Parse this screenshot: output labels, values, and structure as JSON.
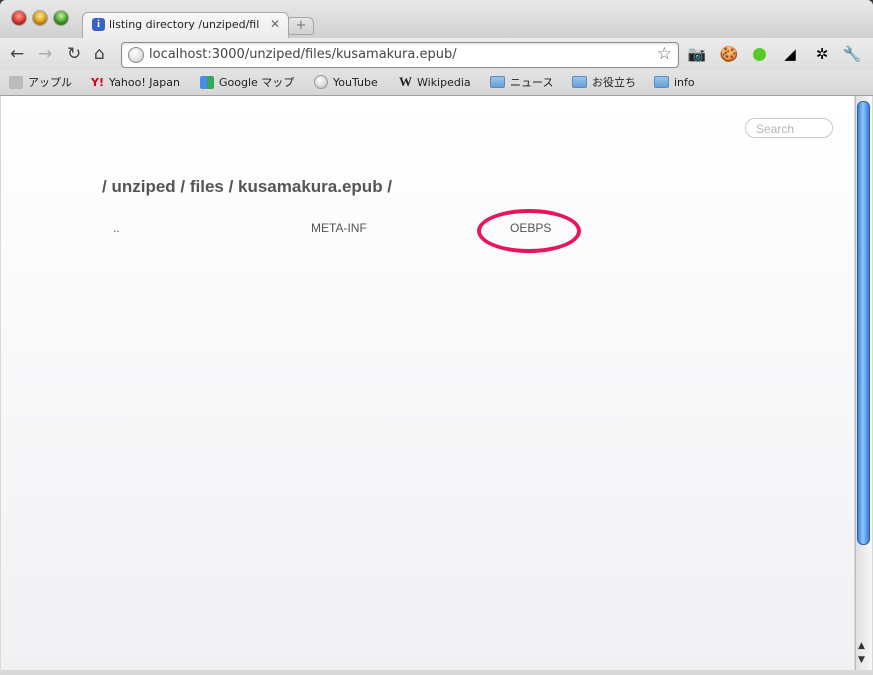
{
  "tab": {
    "title": "listing directory /unziped/fil",
    "favicon": "info-icon",
    "close": "✕"
  },
  "newtab": {
    "label": "+"
  },
  "toolbar": {
    "back": "←",
    "forward": "→",
    "reload": "↻",
    "home": "⌂",
    "url": "localhost:3000/unziped/files/kusamakura.epub/",
    "star": "☆",
    "extensions": [
      "camera-icon",
      "cookie-icon",
      "green-dot-icon",
      "speed-icon",
      "bug-icon",
      "wrench-icon"
    ]
  },
  "bookmarks": [
    {
      "label": "アップル",
      "icon": "apple-icon"
    },
    {
      "label": "Yahoo! Japan",
      "icon": "yahoo-icon"
    },
    {
      "label": "Google マップ",
      "icon": "google-maps-icon"
    },
    {
      "label": "YouTube",
      "icon": "globe-icon"
    },
    {
      "label": "Wikipedia",
      "icon": "wikipedia-icon"
    },
    {
      "label": "ニュース",
      "icon": "folder-icon"
    },
    {
      "label": "お役立ち",
      "icon": "folder-icon"
    },
    {
      "label": "info",
      "icon": "folder-icon"
    }
  ],
  "page": {
    "search_placeholder": "Search",
    "path": "/ unziped / files / kusamakura.epub /",
    "entries": [
      "..",
      "META-INF",
      "OEBPS"
    ],
    "highlight_color": "#e8155c"
  }
}
